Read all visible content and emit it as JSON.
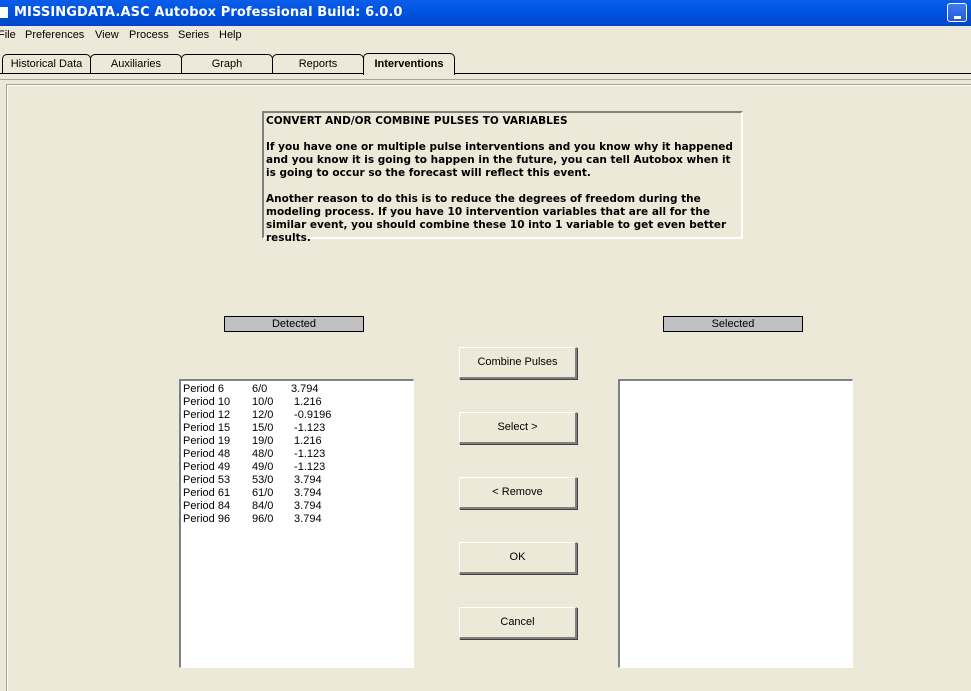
{
  "window": {
    "title": "MISSINGDATA.ASC  Autobox Professional Build: 6.0.0",
    "minimize_label": "Minimize"
  },
  "menu": [
    "File",
    "Preferences",
    "View",
    "Process",
    "Series",
    "Help"
  ],
  "tabs": [
    {
      "label": "Historical Data",
      "active": false
    },
    {
      "label": "Auxiliaries",
      "active": false
    },
    {
      "label": "Graph",
      "active": false
    },
    {
      "label": "Reports",
      "active": false
    },
    {
      "label": "Interventions",
      "active": true
    }
  ],
  "info": {
    "heading": "CONVERT AND/OR COMBINE PULSES TO VARIABLES",
    "paragraph1": "If you have one or multiple pulse interventions and you know why it happened and you know it is going to happen in the future, you can tell Autobox when it is going to occur so the forecast will reflect this event.",
    "paragraph2": "Another reason to do this is to reduce the degrees of freedom during the modeling process.  If you have 10 intervention variables that are all for the similar event, you should combine these 10 into 1 variable to get even better results."
  },
  "detected": {
    "label": "Detected",
    "items": [
      {
        "period": "Period 6",
        "code": "6/0",
        "value": "3.794"
      },
      {
        "period": "Period 10",
        "code": "10/0",
        "value": " 1.216"
      },
      {
        "period": "Period 12",
        "code": "12/0",
        "value": " -0.9196"
      },
      {
        "period": "Period 15",
        "code": "15/0",
        "value": " -1.123"
      },
      {
        "period": "Period 19",
        "code": "19/0",
        "value": " 1.216"
      },
      {
        "period": "Period 48",
        "code": "48/0",
        "value": " -1.123"
      },
      {
        "period": "Period 49",
        "code": "49/0",
        "value": " -1.123"
      },
      {
        "period": "Period 53",
        "code": "53/0",
        "value": " 3.794"
      },
      {
        "period": "Period 61",
        "code": "61/0",
        "value": " 3.794"
      },
      {
        "period": "Period 84",
        "code": "84/0",
        "value": " 3.794"
      },
      {
        "period": "Period 96",
        "code": "96/0",
        "value": " 3.794"
      }
    ]
  },
  "selected": {
    "label": "Selected",
    "items": []
  },
  "buttons": {
    "combine": "Combine Pulses",
    "select": "Select >",
    "remove": "< Remove",
    "ok": "OK",
    "cancel": "Cancel"
  }
}
